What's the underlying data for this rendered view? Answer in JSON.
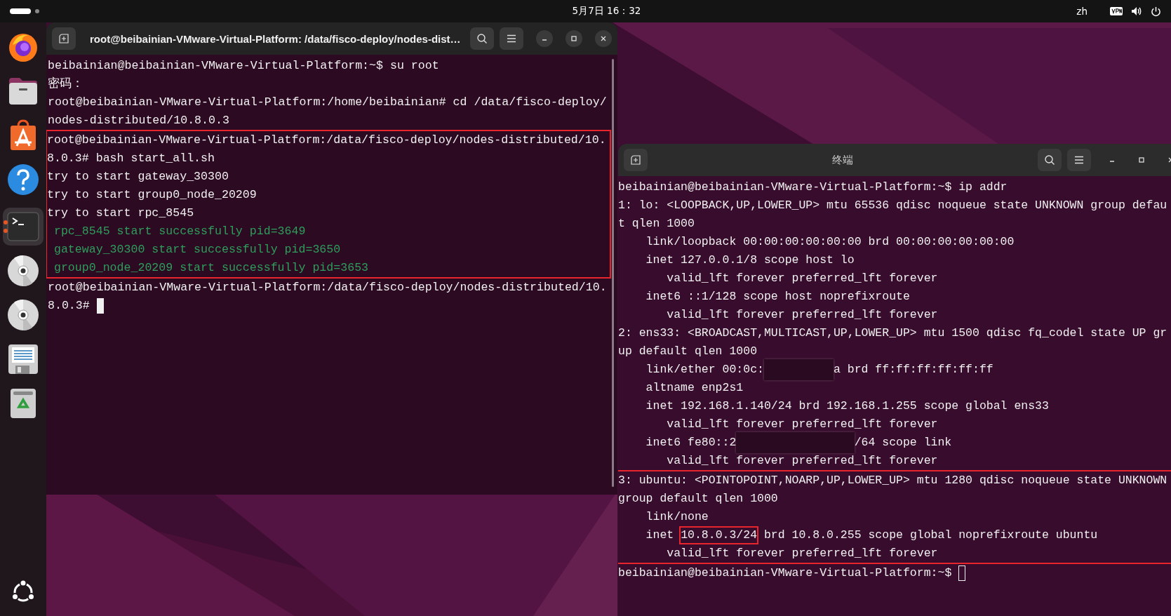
{
  "top_bar": {
    "clock": "5月7日 16：32",
    "input_method": "zh"
  },
  "dock": {
    "items": [
      {
        "kind": "firefox",
        "focused": false,
        "running": false
      },
      {
        "kind": "files",
        "focused": false,
        "running": false
      },
      {
        "kind": "app-center",
        "focused": false,
        "running": false
      },
      {
        "kind": "help",
        "focused": false,
        "running": false
      },
      {
        "kind": "terminal",
        "focused": true,
        "running": true
      },
      {
        "kind": "disc",
        "focused": false,
        "running": false
      },
      {
        "kind": "disc",
        "focused": false,
        "running": false
      },
      {
        "kind": "editor",
        "focused": false,
        "running": false
      },
      {
        "kind": "trash",
        "focused": false,
        "running": false
      }
    ]
  },
  "windows": [
    {
      "title": "root@beibainian-VMware-Virtual-Platform: /data/fisco-deploy/nodes-dist…",
      "focused": true,
      "blocks": [
        {
          "highlighted": false,
          "lines": [
            {
              "kind": "normal",
              "text": "beibainian@beibainian-VMware-Virtual-Platform:~$ su root"
            },
            {
              "kind": "normal",
              "text": "密码："
            },
            {
              "kind": "normal",
              "text": "root@beibainian-VMware-Virtual-Platform:/home/beibainian# cd /data/fisco-deploy/"
            },
            {
              "kind": "normal",
              "text": "nodes-distributed/10.8.0.3"
            }
          ]
        },
        {
          "highlighted": true,
          "lines": [
            {
              "kind": "normal",
              "text": "root@beibainian-VMware-Virtual-Platform:/data/fisco-deploy/nodes-distributed/10."
            },
            {
              "kind": "normal",
              "text": "8.0.3# bash start_all.sh"
            },
            {
              "kind": "normal",
              "text": "try to start gateway_30300"
            },
            {
              "kind": "normal",
              "text": "try to start group0_node_20209"
            },
            {
              "kind": "normal",
              "text": "try to start rpc_8545"
            },
            {
              "kind": "success",
              "text": " rpc_8545 start successfully pid=3649"
            },
            {
              "kind": "success",
              "text": " gateway_30300 start successfully pid=3650"
            },
            {
              "kind": "success",
              "text": " group0_node_20209 start successfully pid=3653"
            }
          ]
        },
        {
          "highlighted": false,
          "lines": [
            {
              "kind": "normal",
              "text": "root@beibainian-VMware-Virtual-Platform:/data/fisco-deploy/nodes-distributed/10."
            },
            {
              "kind": "normal",
              "text": "8.0.3#",
              "cursor": true
            }
          ]
        }
      ]
    },
    {
      "title": "终端",
      "focused": false,
      "blocks": [
        {
          "highlighted": false,
          "lines": [
            {
              "kind": "normal",
              "text": "beibainian@beibainian-VMware-Virtual-Platform:~$ ip addr"
            },
            {
              "kind": "normal",
              "text": "1: lo: <LOOPBACK,UP,LOWER_UP> mtu 65536 qdisc noqueue state UNKNOWN group defau"
            },
            {
              "kind": "normal",
              "text": "t qlen 1000"
            },
            {
              "kind": "normal",
              "text": "    link/loopback 00:00:00:00:00:00 brd 00:00:00:00:00:00"
            },
            {
              "kind": "normal",
              "text": "    inet 127.0.0.1/8 scope host lo"
            },
            {
              "kind": "normal",
              "text": "       valid_lft forever preferred_lft forever"
            },
            {
              "kind": "normal",
              "text": "    inet6 ::1/128 scope host noprefixroute"
            },
            {
              "kind": "normal",
              "text": "       valid_lft forever preferred_lft forever"
            },
            {
              "kind": "normal",
              "text": "2: ens33: <BROADCAST,MULTICAST,UP,LOWER_UP> mtu 1500 qdisc fq_codel state UP gr"
            },
            {
              "kind": "normal",
              "text": "up default qlen 1000"
            },
            {
              "kind": "normal",
              "segments": [
                {
                  "kind": "text",
                  "text": "    link/ether 00:0c:"
                },
                {
                  "kind": "redacted"
                },
                {
                  "kind": "text",
                  "text": "a brd ff:ff:ff:ff:ff:ff"
                }
              ]
            },
            {
              "kind": "normal",
              "text": "    altname enp2s1"
            },
            {
              "kind": "normal",
              "text": "    inet 192.168.1.140/24 brd 192.168.1.255 scope global ens33"
            },
            {
              "kind": "normal",
              "text": "       valid_lft forever preferred_lft forever"
            },
            {
              "kind": "normal",
              "segments": [
                {
                  "kind": "text",
                  "text": "    inet6 fe80::2"
                },
                {
                  "kind": "redacted"
                },
                {
                  "kind": "text",
                  "text": "/64 scope link"
                }
              ]
            },
            {
              "kind": "normal",
              "text": "       valid_lft forever preferred_lft forever"
            }
          ]
        },
        {
          "highlighted": true,
          "lines": [
            {
              "kind": "normal",
              "text": "3: ubuntu: <POINTOPOINT,NOARP,UP,LOWER_UP> mtu 1280 qdisc noqueue state UNKNOWN"
            },
            {
              "kind": "normal",
              "text": "group default qlen 1000"
            },
            {
              "kind": "normal",
              "text": "    link/none"
            },
            {
              "kind": "normal",
              "segments": [
                {
                  "kind": "text",
                  "text": "    inet "
                },
                {
                  "kind": "boxed",
                  "text": "10.8.0.3/24"
                },
                {
                  "kind": "text",
                  "text": " brd 10.8.0.255 scope global noprefixroute ubuntu"
                }
              ]
            },
            {
              "kind": "normal",
              "text": "       valid_lft forever preferred_lft forever"
            }
          ]
        },
        {
          "highlighted": false,
          "lines": [
            {
              "kind": "normal",
              "text": "beibainian@beibainian-VMware-Virtual-Platform:~$",
              "cursor": true
            }
          ]
        }
      ]
    }
  ]
}
